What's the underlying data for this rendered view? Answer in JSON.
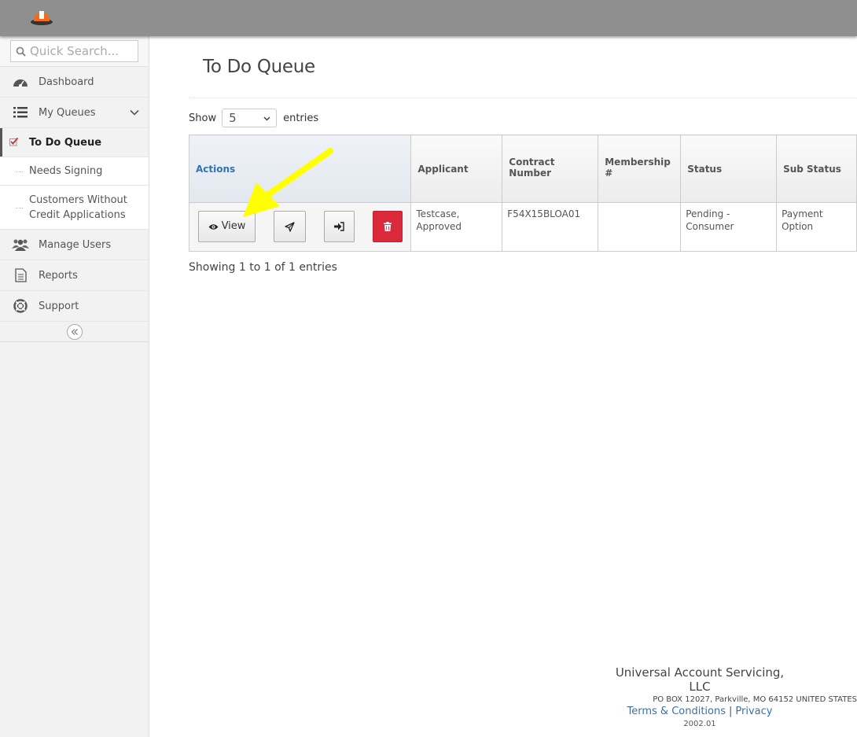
{
  "search": {
    "placeholder": "Quick Search..."
  },
  "sidebar": {
    "items": [
      {
        "label": "Dashboard",
        "icon": "dashboard-icon"
      },
      {
        "label": "My Queues",
        "icon": "list-icon"
      },
      {
        "label": "Manage Users",
        "icon": "users-icon"
      },
      {
        "label": "Reports",
        "icon": "document-icon"
      },
      {
        "label": "Support",
        "icon": "lifebuoy-icon"
      }
    ],
    "queues": [
      {
        "label": "To Do Queue",
        "active": true
      },
      {
        "label": "Needs Signing"
      },
      {
        "label": "Customers Without Credit Applications"
      }
    ]
  },
  "main": {
    "title": "To Do Queue",
    "show_label": "Show",
    "entries_label": "entries",
    "page_length": "5",
    "table": {
      "headers": [
        "Actions",
        "Applicant",
        "Contract Number",
        "Membership #",
        "Status",
        "Sub Status"
      ],
      "rows": [
        {
          "view_label": "View",
          "applicant": "Testcase, Approved",
          "contract_number": "F54X15BLOA01",
          "membership": "",
          "status": "Pending - Consumer",
          "sub_status": "Payment Option"
        }
      ]
    },
    "info": "Showing 1 to 1 of 1 entries"
  },
  "footer": {
    "company": "Universal Account Servicing, LLC",
    "address": "PO BOX 12027, Parkville, MO 64152 UNITED STATES",
    "terms": "Terms & Conditions",
    "separator": "|",
    "privacy": "Privacy",
    "version": "2002.01"
  },
  "colors": {
    "topbar": "#8f8f8f",
    "link": "#3572b0",
    "delete": "#d9293a",
    "annotation_arrow": "#ffff00"
  }
}
